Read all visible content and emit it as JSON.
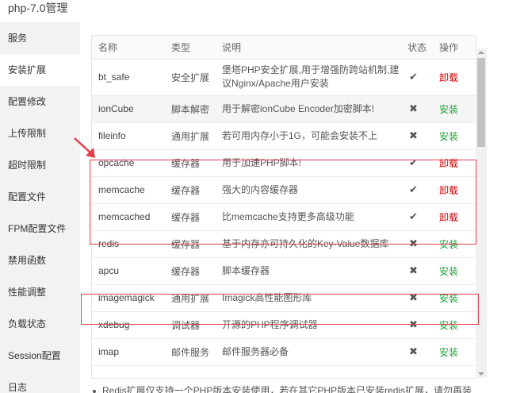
{
  "window": {
    "title": "php-7.0管理"
  },
  "sidebar": {
    "items": [
      {
        "label": "服务"
      },
      {
        "label": "安装扩展"
      },
      {
        "label": "配置修改"
      },
      {
        "label": "上传限制"
      },
      {
        "label": "超时限制"
      },
      {
        "label": "配置文件"
      },
      {
        "label": "FPM配置文件"
      },
      {
        "label": "禁用函数"
      },
      {
        "label": "性能调整"
      },
      {
        "label": "负载状态"
      },
      {
        "label": "Session配置"
      },
      {
        "label": "日志"
      }
    ],
    "active_index": 1
  },
  "table": {
    "headers": {
      "name": "名称",
      "type": "类型",
      "desc": "说明",
      "status": "状态",
      "action": "操作"
    },
    "rows": [
      {
        "name": "bt_safe",
        "type": "安全扩展",
        "desc": "堡塔PHP安全扩展,用于增强防跨站机制,建议Nginx/Apache用户安装",
        "status": "✔",
        "action": "卸载",
        "installed": true
      },
      {
        "name": "ionCube",
        "type": "脚本解密",
        "desc": "用于解密ionCube Encoder加密脚本!",
        "status": "✖",
        "action": "安装",
        "installed": false
      },
      {
        "name": "fileinfo",
        "type": "通用扩展",
        "desc": "若可用内存小于1G，可能会安装不上",
        "status": "✖",
        "action": "安装",
        "installed": false
      },
      {
        "name": "opcache",
        "type": "缓存器",
        "desc": "用于加速PHP脚本!",
        "status": "✔",
        "action": "卸载",
        "installed": true
      },
      {
        "name": "memcache",
        "type": "缓存器",
        "desc": "强大的内容缓存器",
        "status": "✔",
        "action": "卸载",
        "installed": true
      },
      {
        "name": "memcached",
        "type": "缓存器",
        "desc": "比memcache支持更多高级功能",
        "status": "✔",
        "action": "卸载",
        "installed": true
      },
      {
        "name": "redis",
        "type": "缓存器",
        "desc": "基于内存亦可持久化的Key-Value数据库",
        "status": "✖",
        "action": "安装",
        "installed": false
      },
      {
        "name": "apcu",
        "type": "缓存器",
        "desc": "脚本缓存器",
        "status": "✖",
        "action": "安装",
        "installed": false
      },
      {
        "name": "imagemagick",
        "type": "通用扩展",
        "desc": "Imagick高性能图形库",
        "status": "✖",
        "action": "安装",
        "installed": false
      },
      {
        "name": "xdebug",
        "type": "调试器",
        "desc": "开源的PHP程序调试器",
        "status": "✖",
        "action": "安装",
        "installed": false
      },
      {
        "name": "imap",
        "type": "邮件服务",
        "desc": "邮件服务器必备",
        "status": "✖",
        "action": "安装",
        "installed": false
      }
    ]
  },
  "note": {
    "text": "Redis扩展仅支持一个PHP版本安装使用，若在其它PHP版本已安装redis扩展，请勿再装"
  },
  "colors": {
    "uninstall": "#cc0000",
    "install": "#20a53a",
    "highlight_box": "#e0404a"
  }
}
